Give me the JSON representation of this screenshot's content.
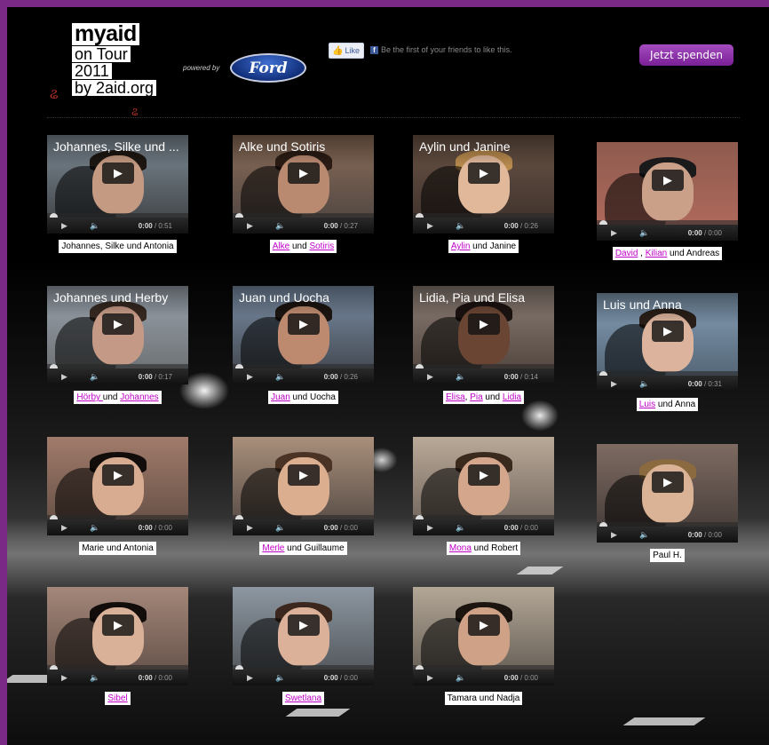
{
  "header": {
    "logo_lines": [
      "myaid",
      "on Tour",
      "2011",
      "by 2aid.org"
    ],
    "powered_by": "powered by",
    "sponsor_logo": "Ford",
    "fb_like_label": "Like",
    "fb_text": "Be the first of your friends to like this.",
    "donate_label": "Jetzt spenden"
  },
  "videos": [
    {
      "title": "Johannes, Silke und ...",
      "time": "0:00",
      "duration": "0:51",
      "caption": [
        {
          "t": "Johannes, Silke und Antonia",
          "link": false
        }
      ]
    },
    {
      "title": "Alke und Sotiris",
      "time": "0:00",
      "duration": "0:27",
      "caption": [
        {
          "t": "Alke",
          "link": true
        },
        {
          "t": " und ",
          "link": false
        },
        {
          "t": "Sotiris",
          "link": true
        }
      ]
    },
    {
      "title": "Aylin und Janine",
      "time": "0:00",
      "duration": "0:26",
      "caption": [
        {
          "t": "Aylin",
          "link": true
        },
        {
          "t": " und Janine",
          "link": false
        }
      ]
    },
    {
      "title": "",
      "time": "0:00",
      "duration": "0:00",
      "caption": [
        {
          "t": "David",
          "link": true
        },
        {
          "t": " , ",
          "link": false
        },
        {
          "t": "Kilian",
          "link": true
        },
        {
          "t": " und Andreas",
          "link": false
        }
      ]
    },
    {
      "title": "Johannes und Herby",
      "time": "0:00",
      "duration": "0:17",
      "caption": [
        {
          "t": "Hörby ",
          "link": true
        },
        {
          "t": " und ",
          "link": false
        },
        {
          "t": "Johannes",
          "link": true
        }
      ]
    },
    {
      "title": "Juan und Uocha",
      "time": "0:00",
      "duration": "0:26",
      "caption": [
        {
          "t": "Juan",
          "link": true
        },
        {
          "t": " und Uocha",
          "link": false
        }
      ]
    },
    {
      "title": "Lidia, Pia und Elisa",
      "time": "0:00",
      "duration": "0:14",
      "caption": [
        {
          "t": "Elisa",
          "link": true
        },
        {
          "t": ", ",
          "link": false
        },
        {
          "t": "Pia",
          "link": true
        },
        {
          "t": " und ",
          "link": false
        },
        {
          "t": "Lidia",
          "link": true
        }
      ]
    },
    {
      "title": "Luis und Anna",
      "time": "0:00",
      "duration": "0:31",
      "caption": [
        {
          "t": "Luis",
          "link": true
        },
        {
          "t": " und Anna",
          "link": false
        }
      ]
    },
    {
      "title": "",
      "time": "0:00",
      "duration": "0:00",
      "caption": [
        {
          "t": "Marie und Antonia",
          "link": false
        }
      ]
    },
    {
      "title": "",
      "time": "0:00",
      "duration": "0:00",
      "caption": [
        {
          "t": "Merle",
          "link": true
        },
        {
          "t": " und Guillaume",
          "link": false
        }
      ]
    },
    {
      "title": "",
      "time": "0:00",
      "duration": "0:00",
      "caption": [
        {
          "t": "Mona",
          "link": true
        },
        {
          "t": " und Robert",
          "link": false
        }
      ]
    },
    {
      "title": "",
      "time": "0:00",
      "duration": "0:00",
      "caption": [
        {
          "t": "Paul H.",
          "link": false
        }
      ]
    },
    {
      "title": "",
      "time": "0:00",
      "duration": "0:00",
      "caption": [
        {
          "t": "Sibel",
          "link": true
        }
      ]
    },
    {
      "title": "",
      "time": "0:00",
      "duration": "0:00",
      "caption": [
        {
          "t": "Swetlana",
          "link": true
        }
      ]
    },
    {
      "title": "",
      "time": "0:00",
      "duration": "0:00",
      "caption": [
        {
          "t": "Tamara und Nadja",
          "link": false
        }
      ]
    }
  ]
}
